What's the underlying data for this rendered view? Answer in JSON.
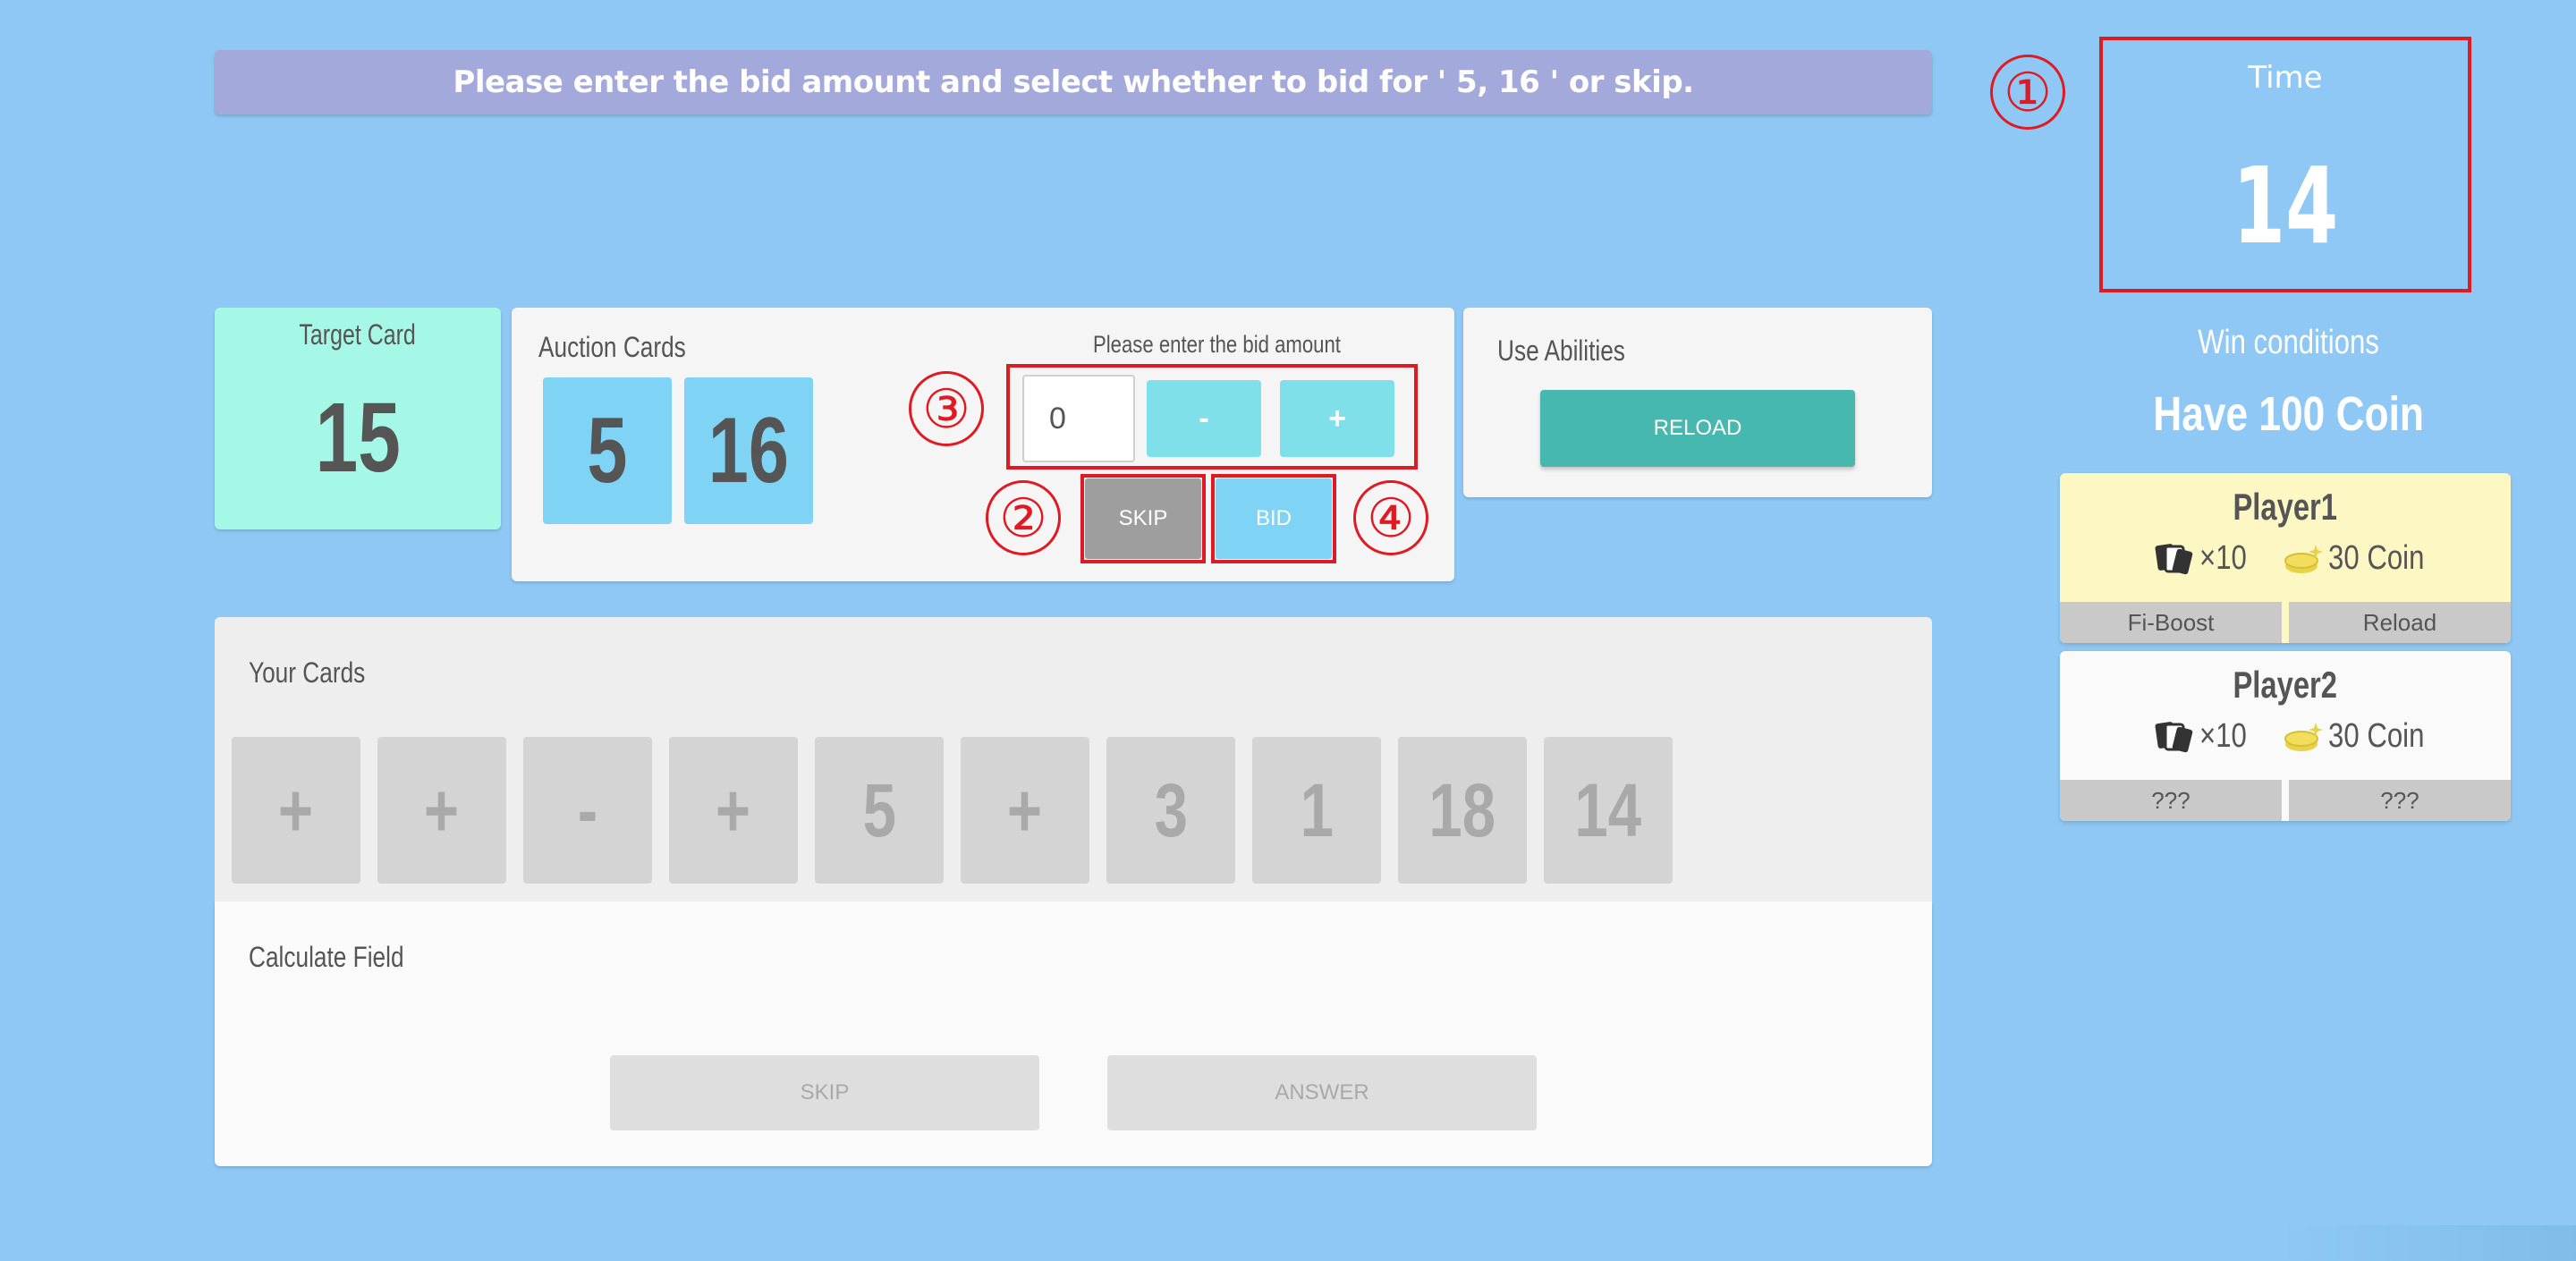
{
  "banner": {
    "text": "Please enter the bid amount and select whether to bid for ' 5, 16 ' or skip."
  },
  "timer": {
    "label": "Time",
    "value": "14"
  },
  "markers": {
    "m1": "①",
    "m2": "②",
    "m3": "③",
    "m4": "④"
  },
  "win": {
    "label": "Win conditions",
    "value": "Have 100 Coin"
  },
  "players": [
    {
      "name": "Player1",
      "cards": "×10",
      "coins": "30 Coin",
      "abilities": [
        "Fi-Boost",
        "Reload"
      ],
      "bg": "#fdf7c4"
    },
    {
      "name": "Player2",
      "cards": "×10",
      "coins": "30 Coin",
      "abilities": [
        "???",
        "???"
      ],
      "bg": "#fafafa"
    }
  ],
  "target": {
    "label": "Target Card",
    "value": "15"
  },
  "auction": {
    "label": "Auction Cards",
    "cards": [
      "5",
      "16"
    ],
    "bid_label": "Please enter the bid amount",
    "bid_value": "0",
    "minus": "-",
    "plus": "+",
    "skip": "SKIP",
    "bid": "BID"
  },
  "abilities": {
    "label": "Use Abilities",
    "reload": "RELOAD"
  },
  "your_cards": {
    "label": "Your Cards",
    "cards": [
      "+",
      "+",
      "-",
      "+",
      "5",
      "+",
      "3",
      "1",
      "18",
      "14"
    ]
  },
  "calc": {
    "label": "Calculate Field",
    "skip": "SKIP",
    "answer": "ANSWER"
  },
  "colors": {
    "accent": "#e01a22",
    "background": "#8fc8f4",
    "coin": "#e8d24a"
  }
}
